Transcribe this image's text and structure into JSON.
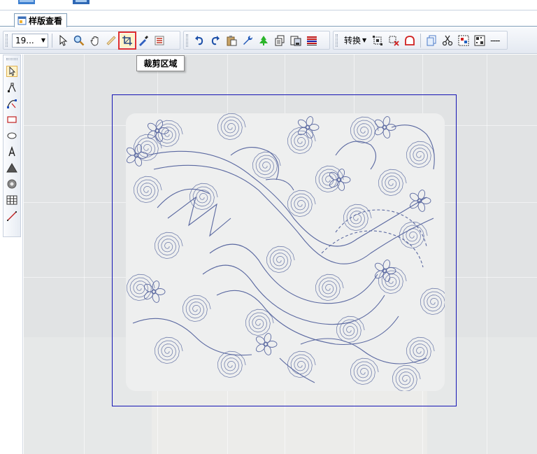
{
  "top_strip": {
    "icons": [
      "document-icon",
      "window-icon"
    ]
  },
  "tabbar": {
    "tab_label": "样版查看"
  },
  "toolbar": {
    "zoom_value": "19...",
    "convert_label": "转换",
    "separator_label": "----",
    "buttons": [
      "pointer-icon",
      "zoom-icon",
      "hand-pan-icon",
      "measure-ruler-icon",
      "crop-icon",
      "eyedropper-icon",
      "properties-list-icon",
      "undo-icon",
      "redo-icon",
      "paste-icon",
      "wrench-icon",
      "tree-icon",
      "copy-icon",
      "save-copy-icon",
      "color-stripes-icon",
      "select-nodes-icon",
      "delete-nodes-icon",
      "shape-outline-icon",
      "duplicate-icon",
      "scissors-icon",
      "image-icon",
      "qr-icon"
    ],
    "active_button": "crop-icon"
  },
  "tooltip": {
    "text": "裁剪区域"
  },
  "left_toolbar": {
    "tools": [
      "select-arrow-icon",
      "node-edit-icon",
      "bezier-icon",
      "rectangle-icon",
      "ellipse-icon",
      "text-icon",
      "fill-triangle-icon",
      "gear-icon",
      "table-grid-icon",
      "line-icon"
    ]
  },
  "colors": {
    "selection_frame": "#1414b4",
    "crop_highlight": "#e03030",
    "canvas_bg": "#e1e3e4",
    "artwork_lines": "#6a78a8"
  }
}
